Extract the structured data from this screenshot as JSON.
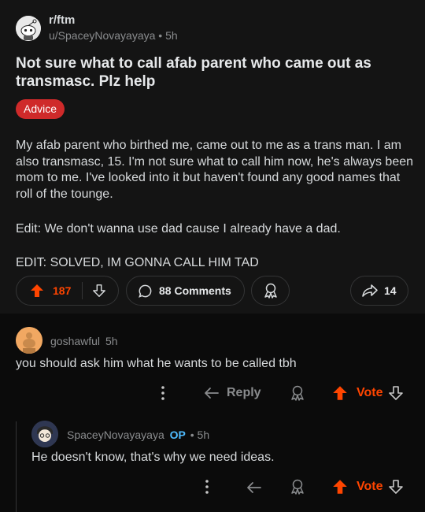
{
  "post": {
    "subreddit": "r/ftm",
    "author_line": "u/SpaceyNovayayaya • 5h",
    "title": "Not sure what to call afab parent who came out as transmasc. Plz help",
    "flair": "Advice",
    "body": [
      "My afab parent who birthed me, came out to me as a trans man. I am also transmasc, 15.  I'm not sure what to call him now, he's always been mom to me. I've looked into it but haven't found any good names that roll of the tounge.",
      "Edit: We don't wanna use dad cause I already have a dad.",
      "EDIT: SOLVED, IM GONNA CALL HIM TAD"
    ],
    "upvotes": "187",
    "comments_label": "88 Comments",
    "shares": "14"
  },
  "comments": [
    {
      "author": "goshawful",
      "time": "5h",
      "body": "you should ask him what he wants to be called tbh",
      "reply_label": "Reply",
      "vote_label": "Vote"
    },
    {
      "author": "SpaceyNovayayaya",
      "op_badge": "OP",
      "time": "• 5h",
      "body": "He doesn't know, that's why we need ideas.",
      "vote_label": "Vote"
    }
  ],
  "colors": {
    "accent": "#ff4500",
    "flair": "#cf2a2a",
    "op": "#4fbcff",
    "background": "#0b0b0b",
    "card": "#141414"
  }
}
